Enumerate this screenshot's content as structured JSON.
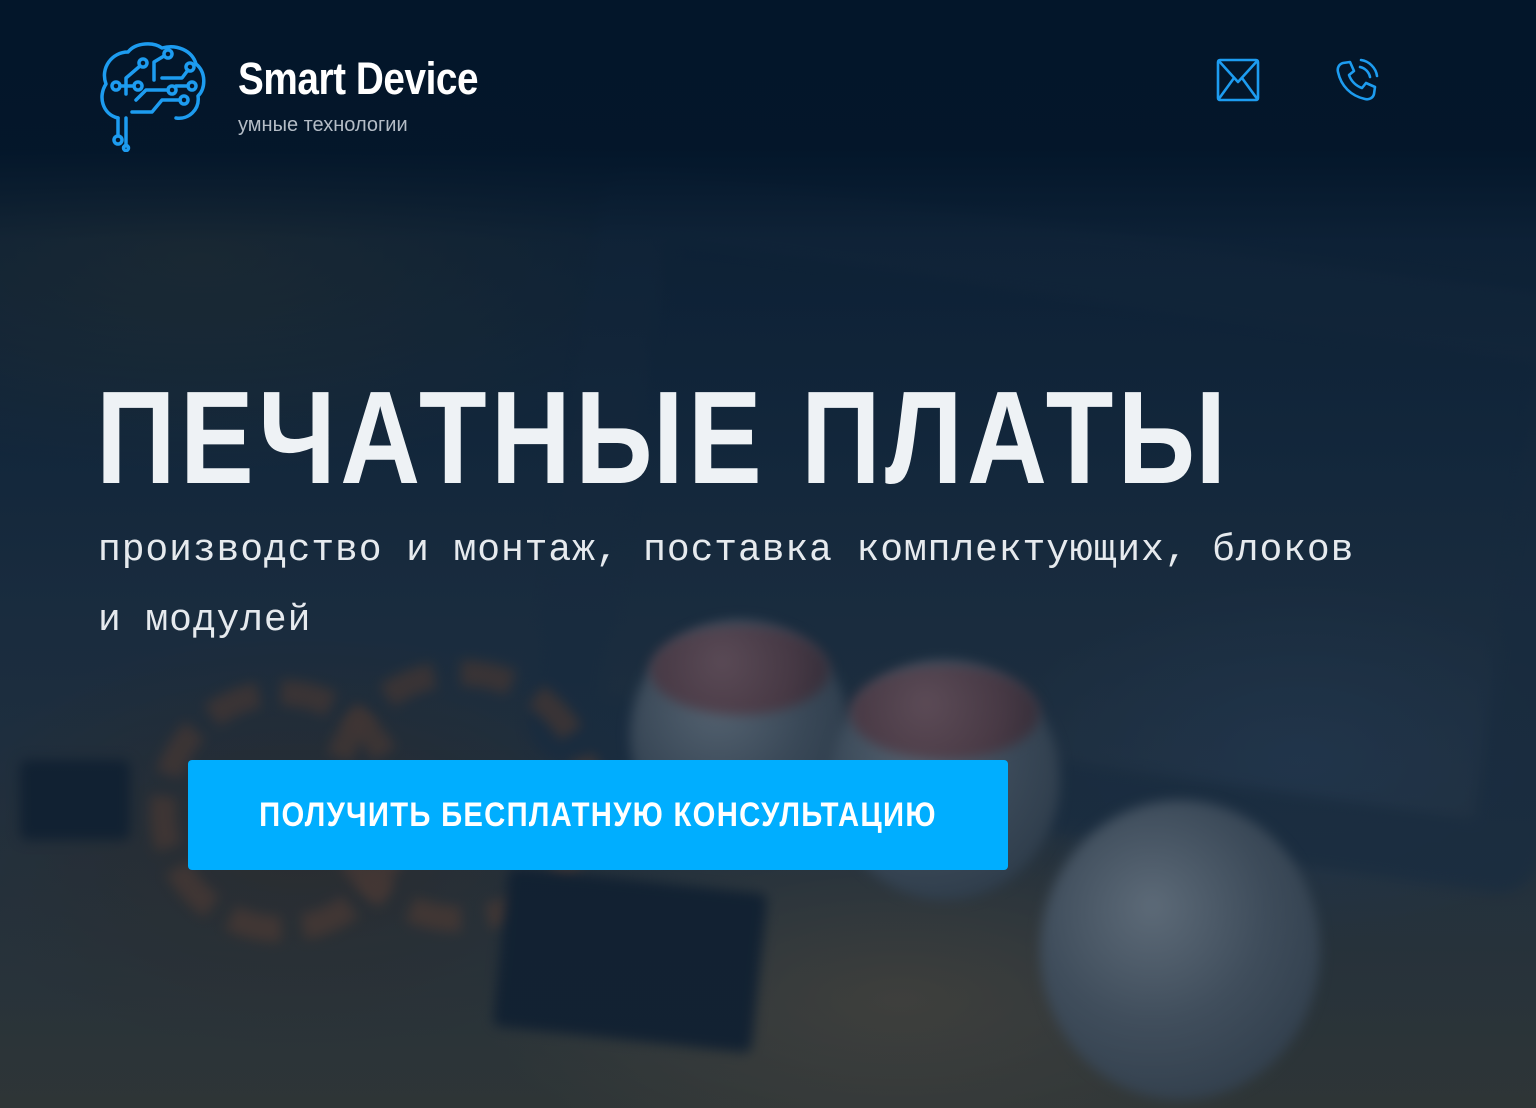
{
  "brand": {
    "name": "Smart Device",
    "tagline": "умные технологии",
    "logo_icon": "circuit-brain-icon"
  },
  "header": {
    "contacts": [
      {
        "icon": "mail-icon"
      },
      {
        "icon": "phone-icon"
      }
    ]
  },
  "hero": {
    "title": "ПЕЧАТНЫЕ ПЛАТЫ",
    "subtitle": "производство и монтаж, поставка комплектующих, блоков и модулей",
    "cta_label": "ПОЛУЧИТЬ БЕСПЛАТНУЮ КОНСУЛЬТАЦИЮ"
  },
  "colors": {
    "accent": "#00aeff",
    "header_bg": "#03162a",
    "title_text": "#eef2f5",
    "tagline_text": "#b4bcc6"
  }
}
